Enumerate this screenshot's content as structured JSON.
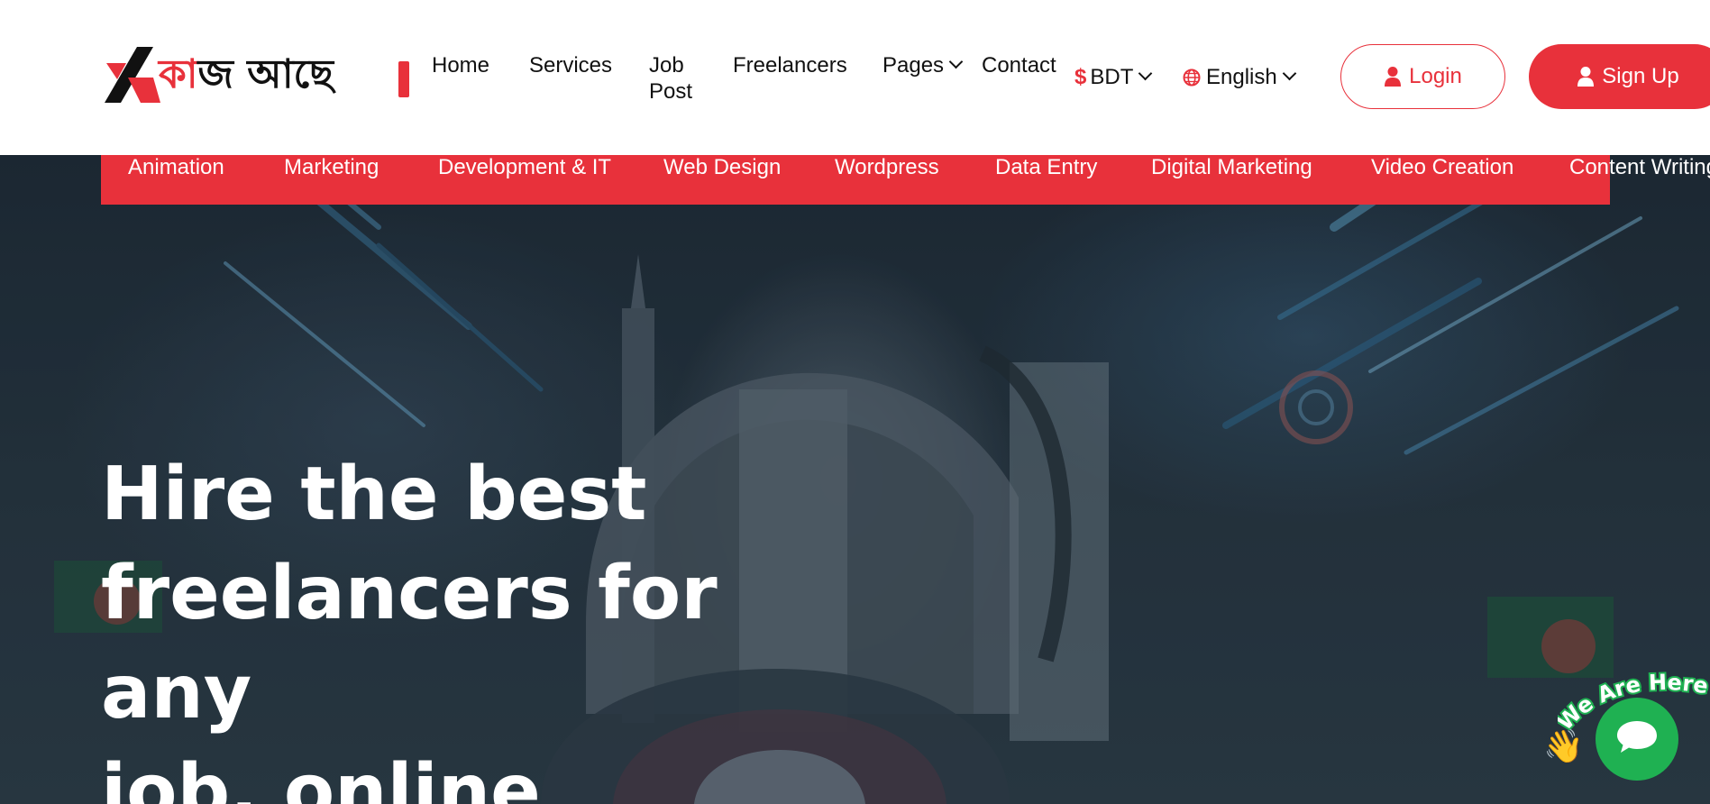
{
  "brand": {
    "logo_text_red": "কা",
    "logo_text_dark": "জ আছে"
  },
  "nav": {
    "items": [
      {
        "label": "Home"
      },
      {
        "label": "Services"
      },
      {
        "label": "Job"
      },
      {
        "label": "Post"
      },
      {
        "label": "Freelancers"
      },
      {
        "label": "Pages"
      },
      {
        "label": "Contact"
      }
    ],
    "currency": "BDT",
    "currency_symbol": "$",
    "language": "English",
    "login_label": "Login",
    "signup_label": "Sign Up"
  },
  "categories": [
    "Animation",
    "Marketing",
    "Development & IT",
    "Web Design",
    "Wordpress",
    "Data Entry",
    "Digital Marketing",
    "Video Creation",
    "Content Writing"
  ],
  "hero": {
    "title_line1": "Hire the best",
    "title_line2": "freelancers for any",
    "title_line3": "job, online"
  },
  "chat": {
    "badge_text": "We Are Here!",
    "wave_emoji": "👋"
  },
  "colors": {
    "accent": "#e8313b",
    "chat_green": "#1fb152"
  }
}
